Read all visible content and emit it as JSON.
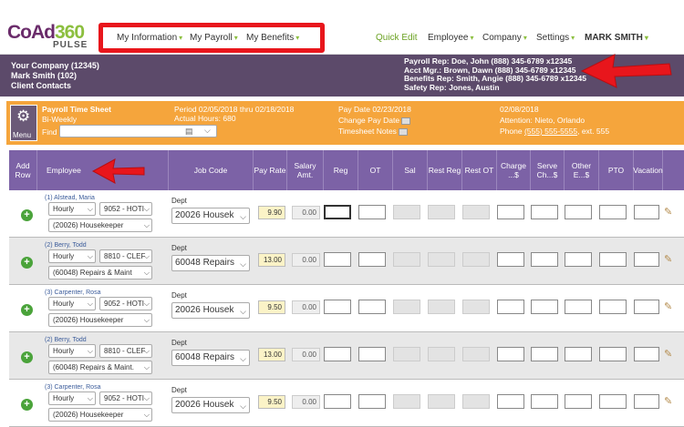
{
  "header": {
    "logo_main": "CoAd",
    "logo_num": "360",
    "logo_sub": "PULSE",
    "nav_left": [
      "My Information",
      "My Payroll",
      "My Benefits"
    ],
    "quick_edit": "Quick Edit",
    "nav_right": [
      "Employee",
      "Company",
      "Settings"
    ],
    "user": "MARK SMITH",
    "caret": "▾"
  },
  "info": {
    "company": "Your Company (12345)",
    "user": "Mark Smith (102)",
    "contacts": "Client Contacts",
    "reps": [
      "Payroll Rep: Doe, John (888) 345-6789 x12345",
      "Acct Mgr.: Brown, Dawn (888) 345-6789 x12345",
      "Benefits Rep: Smith, Angie (888) 345-6789 x12345",
      "Safety Rep: Jones, Austin"
    ]
  },
  "timesheet": {
    "menu_label": "Menu",
    "title": "Payroll Time Sheet",
    "frequency": "Bi-Weekly",
    "find_label": "Find",
    "period": "Period 02/05/2018 thru 02/18/2018",
    "actual_hours": "Actual Hours: 680",
    "pay_date": "Pay Date 02/23/2018",
    "change_pay_date": "Change Pay Date",
    "timesheet_notes": "Timesheet Notes",
    "date": "02/08/2018",
    "attention": "Attention: Nieto, Orlando",
    "phone_label": "Phone",
    "phone": "(555) 555-5555",
    "ext": ", ext. 555"
  },
  "columns": [
    "Add Row",
    "Employee",
    "Job Code",
    "Pay Rate",
    "Salary Amt.",
    "Reg",
    "OT",
    "Sal",
    "Rest Reg",
    "Rest OT",
    "Charge ...$",
    "Serve Ch...$",
    "Other E...$",
    "PTO",
    "Vacation"
  ],
  "rows": [
    {
      "name": "(1) Alstead, Maria",
      "type": "Hourly",
      "code": "9052 - HOTI",
      "job": "(20026) Housekeeper",
      "dept_label": "Dept",
      "dept": "20026 Housek",
      "rate": "9.90",
      "salary": "0.00"
    },
    {
      "name": "(2) Berry, Todd",
      "type": "Hourly",
      "code": "8810 - CLEF",
      "job": "(60048) Repairs & Maint",
      "dept_label": "Dept",
      "dept": "60048 Repairs",
      "rate": "13.00",
      "salary": "0.00"
    },
    {
      "name": "(3) Carpenter, Rosa",
      "type": "Hourly",
      "code": "9052 - HOTI",
      "job": "(20026) Housekeeper",
      "dept_label": "Dept",
      "dept": "20026 Housek",
      "rate": "9.50",
      "salary": "0.00"
    },
    {
      "name": "(2) Berry, Todd",
      "type": "Hourly",
      "code": "8810 - CLEF",
      "job": "(60048) Repairs & Maint.",
      "dept_label": "Dept",
      "dept": "60048 Repairs",
      "rate": "13.00",
      "salary": "0.00"
    },
    {
      "name": "(3) Carpenter, Rosa",
      "type": "Hourly",
      "code": "9052 - HOTI",
      "job": "(20026) Housekeeper",
      "dept_label": "Dept",
      "dept": "20026 Housek",
      "rate": "9.50",
      "salary": "0.00"
    }
  ],
  "colors": {
    "accent_green": "#8cbf3f",
    "purple": "#7c62a6",
    "orange": "#f5a53c",
    "annotation_red": "#e8161c"
  }
}
